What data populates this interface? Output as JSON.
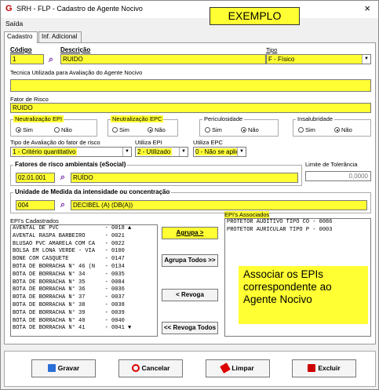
{
  "window": {
    "title": "SRH - FLP - Cadastro de Agente Nocivo",
    "close": "×",
    "app_icon": "G"
  },
  "banner": "EXEMPLO",
  "menu": {
    "saida": "Saída"
  },
  "tabs": [
    "Cadastro",
    "Inf. Adicional"
  ],
  "form": {
    "codigo": {
      "label": "Código",
      "value": "1"
    },
    "descricao": {
      "label": "Descrição",
      "value": "RUIDO"
    },
    "tipo": {
      "label": "Tipo",
      "value": "F - Físico"
    },
    "tecnica": {
      "label": "Tecnica Utilizada para Avaliação do Agente Nocivo",
      "value": ""
    },
    "fator_risco": {
      "label": "Fator de Risco",
      "value": "RUIDO"
    },
    "neut_epi": {
      "label": "Neutralização EPI",
      "sim": "Sim",
      "nao": "Não",
      "selected": "Sim"
    },
    "neut_epc": {
      "label": "Neutralização EPC",
      "sim": "Sim",
      "nao": "Não",
      "selected": "Não"
    },
    "periculosidade": {
      "label": "Periculosidade",
      "sim": "Sim",
      "nao": "Não",
      "selected": "Não"
    },
    "insalubridade": {
      "label": "Insalubridade",
      "sim": "Sim",
      "nao": "Não",
      "selected": "Não"
    },
    "tipo_avaliacao": {
      "label": "Tipo de Avaliação do fator de risco",
      "value": "1 - Critério quantitativo"
    },
    "utiliza_epi": {
      "label": "Utiliza EPI",
      "value": "2 - Utilizado"
    },
    "utiliza_epc": {
      "label": "Utiliza EPC",
      "value": "0 - Não se aplica"
    },
    "fatores_esocial": {
      "label": "Fatores de risco ambientais (eSocial)",
      "code": "02.01.001",
      "value": "RUÍDO"
    },
    "limite_tolerancia": {
      "label": "Limite de Tolerância",
      "value": "0,0000"
    },
    "unidade_medida": {
      "label": "Unidade de Medida da intensidade ou concentração",
      "code": "004",
      "value": "DECIBEL (A) (DB(A))"
    }
  },
  "epis_cadastrados": {
    "label": "EPI's Cadastrados",
    "items": [
      "AVENTAL DE PVC              - 0018 ▲",
      "AVENTAL RASPA BARBEIRO      - 0021",
      "BLUSAO PVC AMARELA COM CA   - 0022",
      "BOLSA EM LONA VERDE - VIA   - 0100",
      "BONE COM CASQUETE           - 0147",
      "BOTA DE BORRACHA N° 46 (N   - 0134",
      "BOTA DE BORRACHA N° 34      - 0035",
      "BOTA DE BORRACHA N° 35      - 0084",
      "BOTA DE BORRACHA N° 36      - 0036",
      "BOTA DE BORRACHA N° 37      - 0037",
      "BOTA DE BORRACHA N° 38      - 0038",
      "BOTA DE BORRACHA N° 39      - 0039",
      "BOTA DE BORRACHA N° 40      - 0040",
      "BOTA DE BORRACHA N° 41      - 0041 ▼"
    ]
  },
  "epis_associados": {
    "label": "EPI's Associados",
    "items": [
      "PROTETOR AUDITIVO TIPO CO - 0086",
      "PROTETOR AURICULAR TIPO P - 0003"
    ]
  },
  "actions": {
    "agrupa": "Agrupa >",
    "agrupa_todos": "Agrupa Todos >>",
    "revoga": "< Revoga",
    "revoga_todos": "<< Revoga Todos"
  },
  "note": "Associar os EPIs correspondente ao Agente Nocivo",
  "footer": {
    "gravar": "Gravar",
    "cancelar": "Cancelar",
    "limpar": "Limpar",
    "excluir": "Excluir"
  },
  "colors": {
    "highlight": "#ffff33",
    "accent_icon": "#c00000",
    "search_icon": "#7a2fa8"
  }
}
